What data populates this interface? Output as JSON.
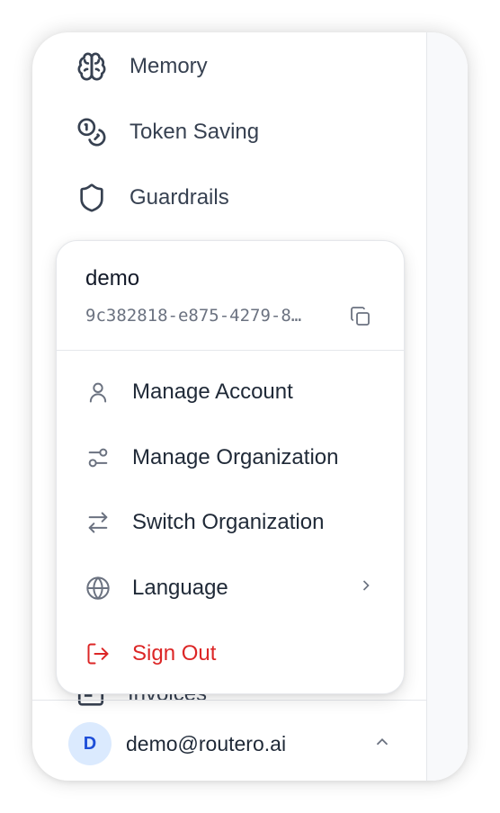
{
  "nav": {
    "items": [
      {
        "label": "Memory",
        "icon": "brain-icon"
      },
      {
        "label": "Token Saving",
        "icon": "coins-icon"
      },
      {
        "label": "Guardrails",
        "icon": "shield-icon"
      }
    ],
    "hidden_item": {
      "label": "Invoices",
      "icon": "invoice-icon"
    }
  },
  "account_menu": {
    "name": "demo",
    "id_text": "9c382818-e875-4279-8…",
    "items": [
      {
        "label": "Manage Account",
        "icon": "user-icon"
      },
      {
        "label": "Manage Organization",
        "icon": "sliders-icon"
      },
      {
        "label": "Switch Organization",
        "icon": "switch-arrows-icon"
      },
      {
        "label": "Language",
        "icon": "globe-icon",
        "has_submenu": true
      },
      {
        "label": "Sign Out",
        "icon": "sign-out-icon",
        "danger": true
      }
    ]
  },
  "footer": {
    "avatar_initial": "D",
    "email": "demo@routero.ai",
    "chevron": "chevron-up-icon"
  },
  "colors": {
    "danger": "#dc2626",
    "avatar_bg": "#dbeafe",
    "avatar_text": "#1d4ed8",
    "text": "#1f2937",
    "muted": "#6b7280"
  }
}
